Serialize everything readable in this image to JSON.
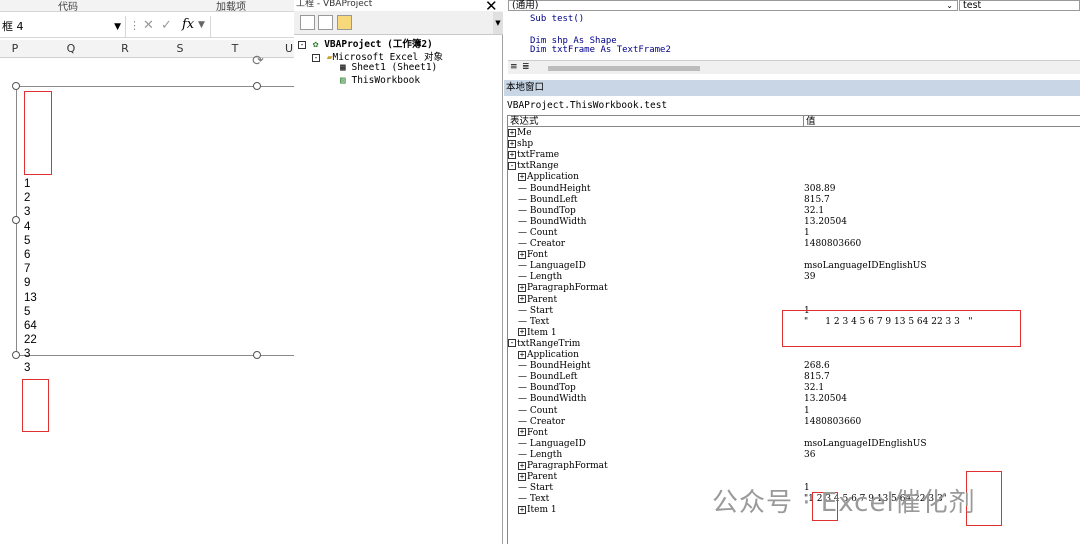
{
  "excel": {
    "ribbon_groups": [
      "代码",
      "加载项"
    ],
    "name_box": "框 4",
    "formula_fx": "fx",
    "columns": [
      "P",
      "Q",
      "R",
      "S",
      "T",
      "U"
    ],
    "textbox_lines": [
      "1",
      "2",
      "3",
      "4",
      "5",
      "6",
      "7",
      "9",
      "13",
      "5",
      "64",
      "22",
      "3",
      "3"
    ]
  },
  "project": {
    "title": "工程 - VBAProject",
    "root": "VBAProject (工作簿2)",
    "folder": "Microsoft Excel 对象",
    "sheet": "Sheet1 (Sheet1)",
    "workbook": "ThisWorkbook"
  },
  "code": {
    "object_combo": "(通用)",
    "proc_combo": "test",
    "lines": [
      "Sub test()",
      "",
      "Dim shp As Shape",
      "Dim txtFrame As TextFrame2"
    ]
  },
  "locals": {
    "title": "本地窗口",
    "path": "VBAProject.ThisWorkbook.test",
    "col_expr": "表达式",
    "col_value": "值",
    "rows": [
      {
        "e": "Me",
        "v": "",
        "pm": "+",
        "indent": 0
      },
      {
        "e": "shp",
        "v": "",
        "pm": "+",
        "indent": 0
      },
      {
        "e": "txtFrame",
        "v": "",
        "pm": "+",
        "indent": 0
      },
      {
        "e": "txtRange",
        "v": "",
        "pm": "-",
        "indent": 0
      },
      {
        "e": "Application",
        "v": "",
        "pm": "+",
        "indent": 1
      },
      {
        "e": "BoundHeight",
        "v": "308.89",
        "pm": "",
        "indent": 1
      },
      {
        "e": "BoundLeft",
        "v": "815.7",
        "pm": "",
        "indent": 1
      },
      {
        "e": "BoundTop",
        "v": "32.1",
        "pm": "",
        "indent": 1
      },
      {
        "e": "BoundWidth",
        "v": "13.20504",
        "pm": "",
        "indent": 1
      },
      {
        "e": "Count",
        "v": "1",
        "pm": "",
        "indent": 1
      },
      {
        "e": "Creator",
        "v": "1480803660",
        "pm": "",
        "indent": 1
      },
      {
        "e": "Font",
        "v": "",
        "pm": "+",
        "indent": 1
      },
      {
        "e": "LanguageID",
        "v": "msoLanguageIDEnglishUS",
        "pm": "",
        "indent": 1
      },
      {
        "e": "Length",
        "v": "39",
        "pm": "",
        "indent": 1
      },
      {
        "e": "ParagraphFormat",
        "v": "",
        "pm": "+",
        "indent": 1
      },
      {
        "e": "Parent",
        "v": "",
        "pm": "+",
        "indent": 1
      },
      {
        "e": "Start",
        "v": "1",
        "pm": "",
        "indent": 1
      },
      {
        "e": "Text",
        "v": "\"      1 2 3 4 5 6 7 9 13 5 64 22 3 3   \"",
        "pm": "",
        "indent": 1
      },
      {
        "e": "Item 1",
        "v": "",
        "pm": "+",
        "indent": 1
      },
      {
        "e": "txtRangeTrim",
        "v": "",
        "pm": "-",
        "indent": 0
      },
      {
        "e": "Application",
        "v": "",
        "pm": "+",
        "indent": 1
      },
      {
        "e": "BoundHeight",
        "v": "268.6",
        "pm": "",
        "indent": 1
      },
      {
        "e": "BoundLeft",
        "v": "815.7",
        "pm": "",
        "indent": 1
      },
      {
        "e": "BoundTop",
        "v": "32.1",
        "pm": "",
        "indent": 1
      },
      {
        "e": "BoundWidth",
        "v": "13.20504",
        "pm": "",
        "indent": 1
      },
      {
        "e": "Count",
        "v": "1",
        "pm": "",
        "indent": 1
      },
      {
        "e": "Creator",
        "v": "1480803660",
        "pm": "",
        "indent": 1
      },
      {
        "e": "Font",
        "v": "",
        "pm": "+",
        "indent": 1
      },
      {
        "e": "LanguageID",
        "v": "msoLanguageIDEnglishUS",
        "pm": "",
        "indent": 1
      },
      {
        "e": "Length",
        "v": "36",
        "pm": "",
        "indent": 1
      },
      {
        "e": "ParagraphFormat",
        "v": "",
        "pm": "+",
        "indent": 1
      },
      {
        "e": "Parent",
        "v": "",
        "pm": "+",
        "indent": 1
      },
      {
        "e": "Start",
        "v": "1",
        "pm": "",
        "indent": 1
      },
      {
        "e": "Text",
        "v": "\"1 2 3 4 5 6 7 9 13 5 64 22 3 3\"",
        "pm": "",
        "indent": 1
      },
      {
        "e": "Item 1",
        "v": "",
        "pm": "+",
        "indent": 1
      }
    ]
  },
  "watermark": "公众号 · Excel催化剂",
  "colors": {
    "highlight": "#e03030",
    "locals_header": "#c8d6e6",
    "keyword": "#00008b"
  }
}
